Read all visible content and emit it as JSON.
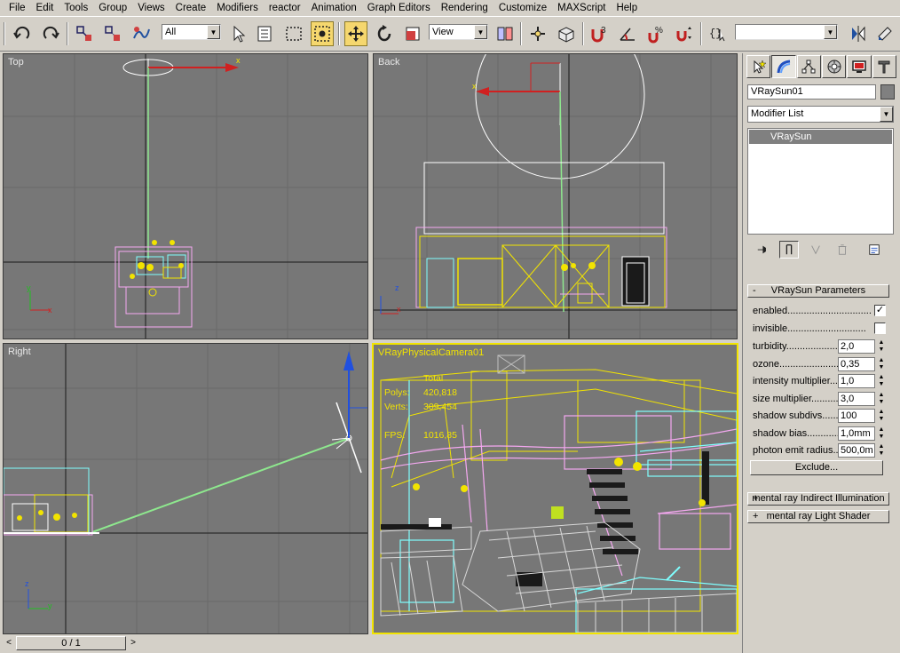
{
  "menu": [
    "File",
    "Edit",
    "Tools",
    "Group",
    "Views",
    "Create",
    "Modifiers",
    "reactor",
    "Animation",
    "Graph Editors",
    "Rendering",
    "Customize",
    "MAXScript",
    "Help"
  ],
  "toolbar": {
    "selection_filter": "All",
    "ref_coord_system": "View",
    "named_selection": "",
    "icons": [
      "undo-icon",
      "redo-icon",
      "select-and-link-icon",
      "unlink-icon",
      "bind-space-warp-icon",
      "select-object-icon",
      "select-by-name-icon",
      "rectangular-selection-icon",
      "window-crossing-icon",
      "select-and-move-icon",
      "select-and-rotate-icon",
      "select-and-scale-icon",
      "pivot-icon",
      "manipulate-icon",
      "keyboard-shortcut-icon",
      "snap-3d-icon",
      "angle-snap-icon",
      "percent-snap-icon",
      "spinner-snap-icon",
      "edit-named-selection-icon",
      "mirror-icon",
      "align-icon"
    ],
    "snap_label": "3",
    "percent_label": "%"
  },
  "viewports": {
    "top": {
      "label": "Top",
      "axis_x": "x",
      "axis_y": "y",
      "gizmo_x": "x"
    },
    "back": {
      "label": "Back",
      "axis_x": "x",
      "axis_y": "z",
      "gizmo_x": "x"
    },
    "right": {
      "label": "Right",
      "axis_x": "y",
      "axis_y": "z"
    },
    "camera": {
      "label": "VRayPhysicalCamera01",
      "stats_header": "Total",
      "polys_label": "Polys:",
      "polys_value": "420,818",
      "verts_label": "Verts:",
      "verts_value": "309,454",
      "fps_label": "FPS:",
      "fps_value": "1016,85"
    }
  },
  "command_panel": {
    "tab_icons": [
      "create-tab-icon",
      "modify-tab-icon",
      "hierarchy-tab-icon",
      "motion-tab-icon",
      "display-tab-icon",
      "utilities-tab-icon"
    ],
    "object_name": "VRaySun01",
    "object_color": "#808080",
    "modifier_list": "Modifier List",
    "stack_items": [
      "VRaySun"
    ],
    "rollout_title": "VRaySun Parameters",
    "rollout_sign": "-",
    "params": [
      {
        "label": "enabled...............................",
        "type": "check",
        "value": "✓"
      },
      {
        "label": "invisible.............................",
        "type": "check",
        "value": ""
      },
      {
        "label": "turbidity......................",
        "type": "spin",
        "value": "2,0"
      },
      {
        "label": "ozone..........................",
        "type": "spin",
        "value": "0,35"
      },
      {
        "label": "intensity multiplier....",
        "type": "spin",
        "value": "1,0"
      },
      {
        "label": "size multiplier..........",
        "type": "spin",
        "value": "3,0"
      },
      {
        "label": "shadow subdivs........",
        "type": "spin",
        "value": "100"
      },
      {
        "label": "shadow bias..............",
        "type": "spin",
        "value": "1,0mm"
      },
      {
        "label": "photon emit radius..",
        "type": "spin",
        "value": "500,0m"
      }
    ],
    "exclude_label": "Exclude...",
    "collapsed_rollouts": [
      {
        "sign": "+",
        "title": "mental ray Indirect Illumination"
      },
      {
        "sign": "+",
        "title": "mental ray Light Shader"
      }
    ]
  },
  "timeslider": {
    "frame": "0 / 1",
    "prev": "<",
    "next": ">"
  },
  "colors": {
    "viewport_bg": "#777777",
    "active_border": "#f2e400",
    "wire_yellow": "#f2e400",
    "wire_pink": "#f4a8f0",
    "wire_cyan": "#7fffff",
    "wire_green": "#8ee88e",
    "light_gizmo": "#ffffff"
  }
}
